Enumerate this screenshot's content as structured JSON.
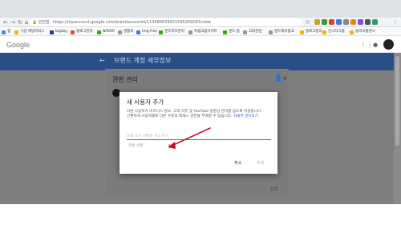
{
  "browser": {
    "secure_label": "안전함",
    "url": "https://myaccount.google.com/brandaccounts/113484639421595269183/view",
    "bookmarks": [
      "앱",
      "구글 애널리틱스",
      "bigday",
      "블로그관리",
      "NAVER",
      "명품직",
      "img-free",
      "엔트리즈관리",
      "독립고립사이트",
      "엔드 홈",
      "고화관련",
      "엔드레서울교",
      "블로그정리",
      "인스타그램",
      "올리브율엔스"
    ],
    "colors": {
      "chrome": "#f1f3f4",
      "tabstrip": "#dee1e6"
    }
  },
  "app": {
    "logo": "Google",
    "header_title": "브랜드 계정 세부정보",
    "colors": {
      "header_blue": "#2a4f88",
      "overlay_gray": "#7f7f7f"
    }
  },
  "permissions_dialog": {
    "title": "권한 관리",
    "done_label": "완료"
  },
  "add_user_dialog": {
    "title": "새 사용자 추가",
    "description": "다른 사용자가 비즈니스 정보, 고객 리뷰 및 YouTube 동영상 관리를 돕도록 허용합니다. 간편하게 사용자별로 다른 수준의 액세스 권한을 부여할 수 있습니다.",
    "learn_more": "자세히 알아보기",
    "email_placeholder": "이름 또는 이메일 주소 추가",
    "role_placeholder": "역할 선택",
    "cancel_label": "취소",
    "invite_label": "초대",
    "colors": {
      "link": "#2a56c6",
      "input_underline": "#3367d6"
    }
  },
  "annotation": {
    "arrow_color": "#c8102e"
  }
}
